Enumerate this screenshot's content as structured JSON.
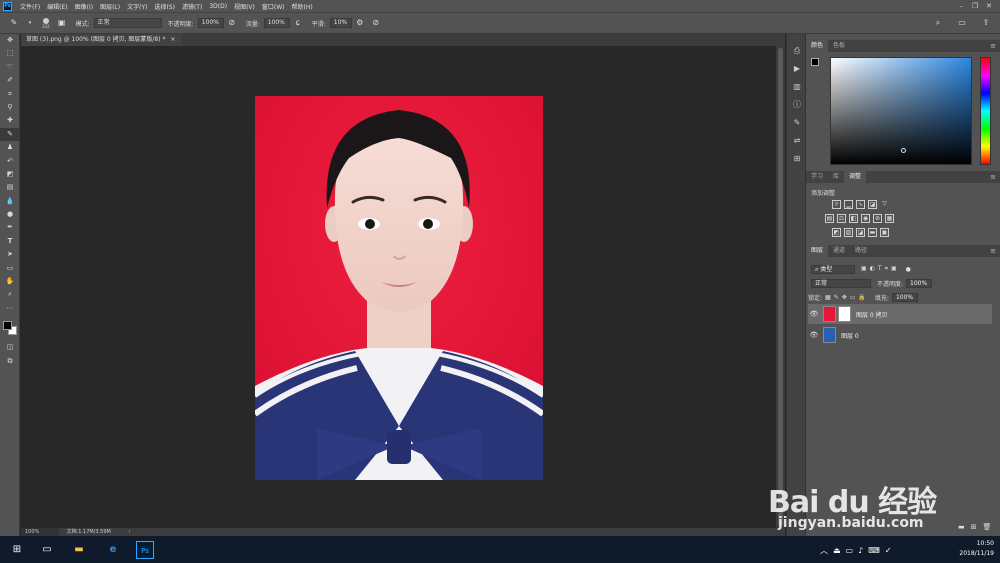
{
  "app": {
    "logo": "Ps"
  },
  "menubar": [
    "文件(F)",
    "编辑(E)",
    "图像(I)",
    "图层(L)",
    "文字(Y)",
    "选择(S)",
    "滤镜(T)",
    "3D(D)",
    "视图(V)",
    "窗口(W)",
    "帮助(H)"
  ],
  "options": {
    "brush_size": "332",
    "mode_label": "模式:",
    "mode_value": "正常",
    "opacity_label": "不透明度:",
    "opacity_value": "100%",
    "flow_label": "流量:",
    "flow_value": "100%",
    "smooth_label": "平滑:",
    "smooth_value": "10%"
  },
  "document": {
    "tab_title": "草图 (3).png @ 100% (图层 0 拷贝, 图层蒙版/8) *",
    "zoom": "100%",
    "doc_info": "文档:1.17M/3.59M"
  },
  "panels": {
    "color_tabs": [
      "颜色",
      "色板"
    ],
    "mid_tabs": [
      "学习",
      "库",
      "调整"
    ],
    "adjust_title": "添加调整",
    "layer_tabs": [
      "图层",
      "通道",
      "路径"
    ],
    "kind_label": "类型",
    "blend_mode": "正常",
    "opacity_label": "不透明度:",
    "opacity_value": "100%",
    "lock_label": "锁定:",
    "fill_label": "填充:",
    "fill_value": "100%"
  },
  "layers": [
    {
      "name": "图层 0 拷贝",
      "selected": true
    },
    {
      "name": "图层 0",
      "selected": false
    }
  ],
  "watermark": {
    "brand": "Bai du 经验",
    "url": "jingyan.baidu.com"
  },
  "taskbar": {
    "time": "10:50",
    "date": "2018/11/19"
  },
  "colors": {
    "photo_background": "#e8153a",
    "uniform": "#2a3578"
  }
}
